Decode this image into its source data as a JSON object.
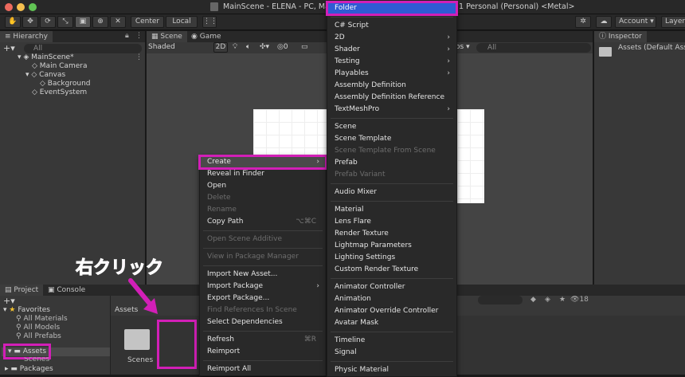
{
  "window": {
    "title": "MainScene - ELENA - PC, Mac",
    "title_suffix": "1 Personal (Personal) <Metal>"
  },
  "toolbar": {
    "center_label": "Center",
    "local_label": "Local",
    "account_label": "Account",
    "layers_label": "Layer"
  },
  "hierarchy": {
    "tab": "Hierarchy",
    "search_placeholder": "All",
    "items": [
      "MainScene*",
      "Main Camera",
      "Canvas",
      "Background",
      "EventSystem"
    ]
  },
  "scene": {
    "tab_scene": "Scene",
    "tab_game": "Game",
    "shading": "Shaded",
    "mode_2d": "2D",
    "gizmo_count": "0",
    "search_placeholder": "All",
    "gizmos_label": "os"
  },
  "inspector": {
    "tab": "Inspector",
    "title": "Assets (Default Asse"
  },
  "project": {
    "tab_project": "Project",
    "tab_console": "Console",
    "favorites_label": "Favorites",
    "favorites": [
      "All Materials",
      "All Models",
      "All Prefabs"
    ],
    "assets_label": "Assets",
    "assets_sub": "Scenes",
    "packages_label": "Packages",
    "breadcrumb": "Assets",
    "folder_label": "Scenes",
    "count": "18"
  },
  "annotation": {
    "right_click": "右クリック",
    "color": "#d21fb7"
  },
  "context_menu": {
    "items": [
      {
        "label": "Create",
        "submenu": true,
        "highlight": true
      },
      {
        "label": "Reveal in Finder"
      },
      {
        "label": "Open"
      },
      {
        "label": "Delete",
        "disabled": true
      },
      {
        "label": "Rename",
        "disabled": true
      },
      {
        "label": "Copy Path",
        "shortcut": "⌥⌘C"
      },
      {
        "sep": true
      },
      {
        "label": "Open Scene Additive",
        "disabled": true
      },
      {
        "sep": true
      },
      {
        "label": "View in Package Manager",
        "disabled": true
      },
      {
        "sep": true
      },
      {
        "label": "Import New Asset..."
      },
      {
        "label": "Import Package",
        "submenu": true
      },
      {
        "label": "Export Package..."
      },
      {
        "label": "Find References In Scene",
        "disabled": true
      },
      {
        "label": "Select Dependencies"
      },
      {
        "sep": true
      },
      {
        "label": "Refresh",
        "shortcut": "⌘R"
      },
      {
        "label": "Reimport"
      },
      {
        "sep": true
      },
      {
        "label": "Reimport All"
      }
    ]
  },
  "create_menu": {
    "items": [
      {
        "label": "Folder",
        "selected": true
      },
      {
        "sep": true
      },
      {
        "label": "C# Script"
      },
      {
        "label": "2D",
        "submenu": true
      },
      {
        "label": "Shader",
        "submenu": true
      },
      {
        "label": "Testing",
        "submenu": true
      },
      {
        "label": "Playables",
        "submenu": true
      },
      {
        "label": "Assembly Definition"
      },
      {
        "label": "Assembly Definition Reference"
      },
      {
        "label": "TextMeshPro",
        "submenu": true
      },
      {
        "sep": true
      },
      {
        "label": "Scene"
      },
      {
        "label": "Scene Template"
      },
      {
        "label": "Scene Template From Scene",
        "disabled": true
      },
      {
        "label": "Prefab"
      },
      {
        "label": "Prefab Variant",
        "disabled": true
      },
      {
        "sep": true
      },
      {
        "label": "Audio Mixer"
      },
      {
        "sep": true
      },
      {
        "label": "Material"
      },
      {
        "label": "Lens Flare"
      },
      {
        "label": "Render Texture"
      },
      {
        "label": "Lightmap Parameters"
      },
      {
        "label": "Lighting Settings"
      },
      {
        "label": "Custom Render Texture"
      },
      {
        "sep": true
      },
      {
        "label": "Animator Controller"
      },
      {
        "label": "Animation"
      },
      {
        "label": "Animator Override Controller"
      },
      {
        "label": "Avatar Mask"
      },
      {
        "sep": true
      },
      {
        "label": "Timeline"
      },
      {
        "label": "Signal"
      },
      {
        "sep": true
      },
      {
        "label": "Physic Material"
      }
    ]
  }
}
